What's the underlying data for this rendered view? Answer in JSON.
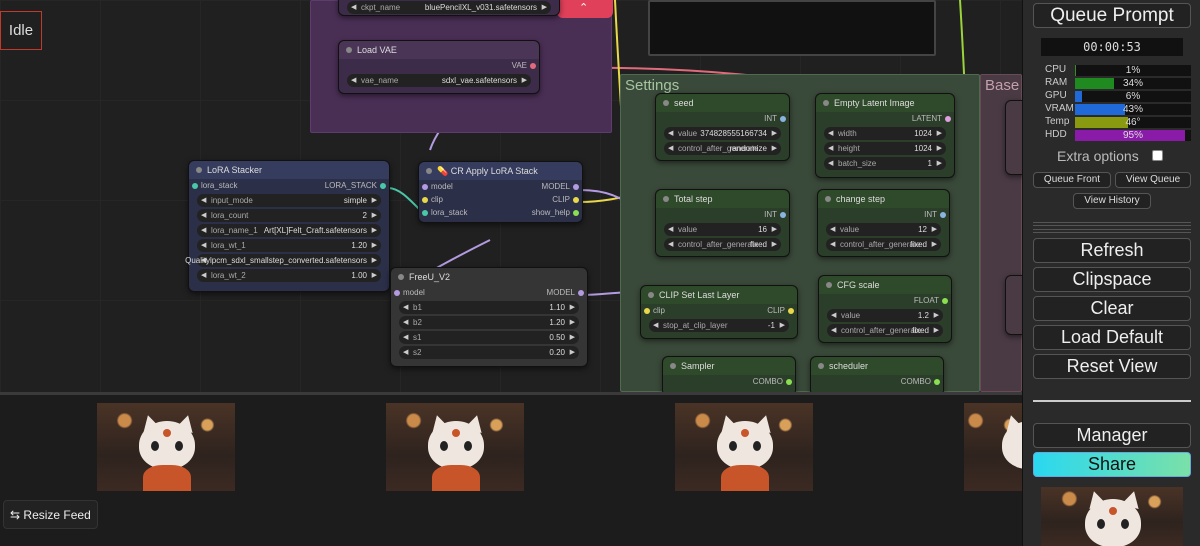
{
  "status": "Idle",
  "feed": {
    "resize_label": "Resize Feed",
    "resize_icon": "resize-arrows-icon"
  },
  "sidebar": {
    "queue_prompt": "Queue Prompt",
    "timer": "00:00:53",
    "monitors": [
      {
        "label": "CPU",
        "value": "1%",
        "level": 0.01,
        "color": "#3a8a2a"
      },
      {
        "label": "RAM",
        "value": "34%",
        "level": 0.34,
        "color": "#1f8a1f"
      },
      {
        "label": "GPU",
        "value": "6%",
        "level": 0.06,
        "color": "#1f6ad8"
      },
      {
        "label": "VRAM",
        "value": "43%",
        "level": 0.43,
        "color": "#1f6ad8"
      },
      {
        "label": "Temp",
        "value": "46°",
        "level": 0.46,
        "color": "#8a9a10"
      },
      {
        "label": "HDD",
        "value": "95%",
        "level": 0.95,
        "color": "#8a1aa8"
      }
    ],
    "extra_options": "Extra options",
    "queue_front": "Queue Front",
    "view_queue": "View Queue",
    "view_history": "View History",
    "refresh": "Refresh",
    "clipspace": "Clipspace",
    "clear": "Clear",
    "load_default": "Load Default",
    "reset_view": "Reset View",
    "manager": "Manager",
    "share": "Share"
  },
  "groups": {
    "settings": "Settings",
    "base": "Base"
  },
  "nodes": {
    "checkpoint": {
      "ckpt_label": "ckpt_name",
      "ckpt_value": "bluePencilXL_v031.safetensors"
    },
    "load_vae": {
      "title": "Load VAE",
      "out": "VAE",
      "vae_label": "vae_name",
      "vae_value": "sdxl_vae.safetensors"
    },
    "lora_stacker": {
      "title": "LoRA Stacker",
      "in": "lora_stack",
      "out": "LORA_STACK",
      "widgets": [
        {
          "label": "input_mode",
          "value": "simple"
        },
        {
          "label": "lora_count",
          "value": "2"
        },
        {
          "label": "lora_name_1",
          "value": "Art[XL]Felt_Craft.safetensors"
        },
        {
          "label": "lora_wt_1",
          "value": "1.20"
        },
        {
          "label": "",
          "value": "Qualitylpcm_sdxl_smallstep_converted.safetensors"
        },
        {
          "label": "lora_wt_2",
          "value": "1.00"
        }
      ]
    },
    "cr_apply_lora": {
      "title": "CR Apply LoRA Stack",
      "inputs": [
        "model",
        "clip",
        "lora_stack"
      ],
      "outputs": [
        "MODEL",
        "CLIP",
        "show_help"
      ]
    },
    "freeu": {
      "title": "FreeU_V2",
      "in": "model",
      "out": "MODEL",
      "widgets": [
        {
          "label": "b1",
          "value": "1.10"
        },
        {
          "label": "b2",
          "value": "1.20"
        },
        {
          "label": "s1",
          "value": "0.50"
        },
        {
          "label": "s2",
          "value": "0.20"
        }
      ]
    },
    "seed": {
      "title": "seed",
      "out": "INT",
      "value_label": "value",
      "value": "374828555166734",
      "control_label": "control_after_generate",
      "control_value": "randomize"
    },
    "empty_latent": {
      "title": "Empty Latent Image",
      "out": "LATENT",
      "width_label": "width",
      "width": "1024",
      "height_label": "height",
      "height": "1024",
      "batch_label": "batch_size",
      "batch": "1"
    },
    "total_step": {
      "title": "Total step",
      "out": "INT",
      "value_label": "value",
      "value": "16",
      "control_label": "control_after_generate",
      "control_value": "fixed"
    },
    "change_step": {
      "title": "change step",
      "out": "INT",
      "value_label": "value",
      "value": "12",
      "control_label": "control_after_generate",
      "control_value": "fixed"
    },
    "clip_set_last": {
      "title": "CLIP Set Last Layer",
      "in": "clip",
      "out": "CLIP",
      "stop_label": "stop_at_clip_layer",
      "stop_value": "-1"
    },
    "cfg_scale": {
      "title": "CFG scale",
      "out": "FLOAT",
      "value_label": "value",
      "value": "1.2",
      "control_label": "control_after_generate",
      "control_value": "fixed"
    },
    "sampler": {
      "title": "Sampler",
      "out": "COMBO"
    },
    "scheduler": {
      "title": "scheduler",
      "out": "COMBO"
    }
  }
}
